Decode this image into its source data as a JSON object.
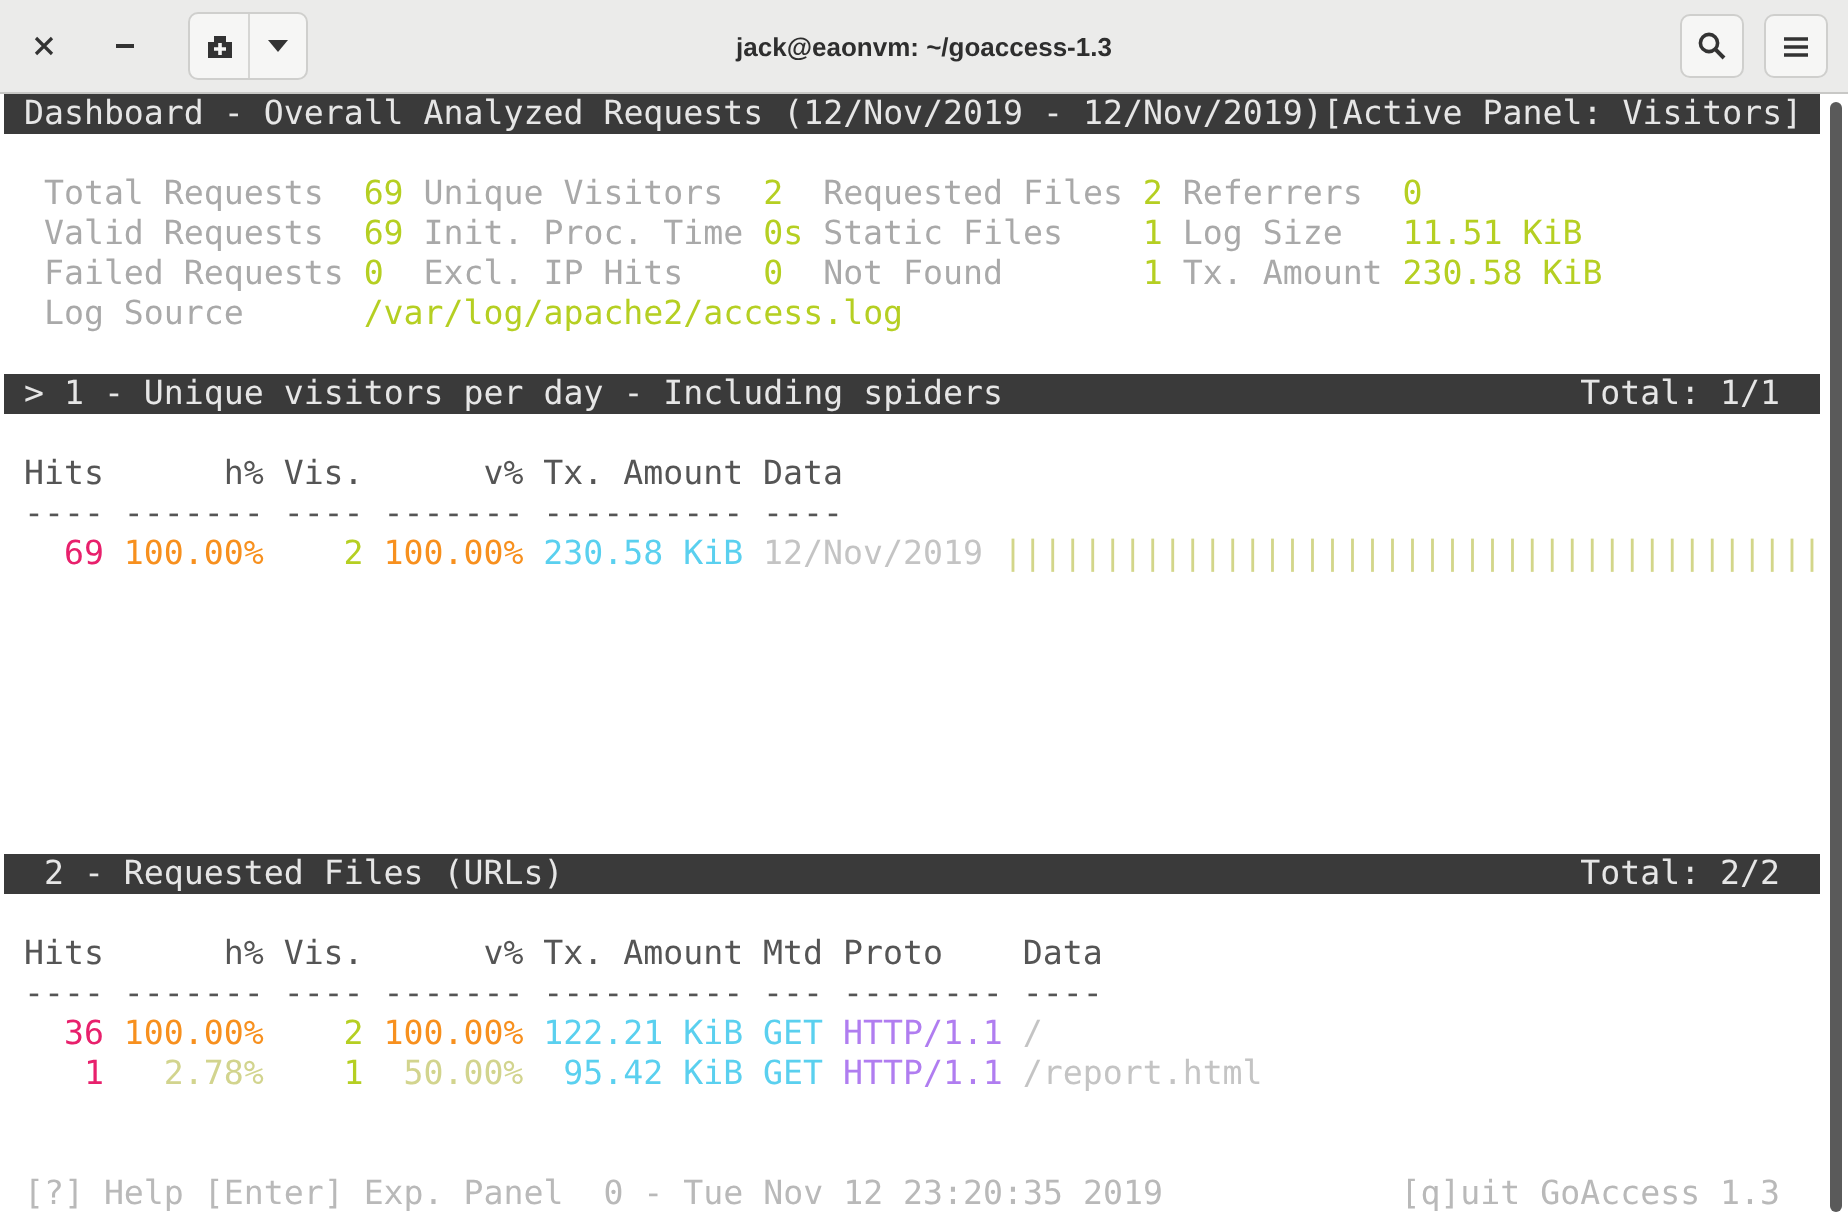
{
  "window": {
    "title": "jack@eaonvm: ~/goaccess-1.3"
  },
  "dashboard": {
    "title": "Dashboard - Overall Analyzed Requests (12/Nov/2019 - 12/Nov/2019)",
    "active_panel": "[Active Panel: Visitors]",
    "stats": [
      [
        {
          "label": "Total Requests",
          "value": "69"
        },
        {
          "label": "Unique Visitors",
          "value": "2"
        },
        {
          "label": "Requested Files",
          "value": "2"
        },
        {
          "label": "Referrers",
          "value": "0"
        }
      ],
      [
        {
          "label": "Valid Requests",
          "value": "69"
        },
        {
          "label": "Init. Proc. Time",
          "value": "0s"
        },
        {
          "label": "Static Files",
          "value": "1"
        },
        {
          "label": "Log Size",
          "value": "11.51 KiB"
        }
      ],
      [
        {
          "label": "Failed Requests",
          "value": "0"
        },
        {
          "label": "Excl. IP Hits",
          "value": "0"
        },
        {
          "label": "Not Found",
          "value": "1"
        },
        {
          "label": "Tx. Amount",
          "value": "230.58 KiB"
        }
      ],
      [
        {
          "label": "Log Source",
          "value": "/var/log/apache2/access.log"
        }
      ]
    ]
  },
  "panels": [
    {
      "marker": ">",
      "title": "1 - Unique visitors per day - Including spiders",
      "total": "Total: 1/1",
      "columns": [
        {
          "kind": "hits",
          "label": "Hits",
          "rule": "----"
        },
        {
          "kind": "percent",
          "label": "h%",
          "rule": "-------"
        },
        {
          "kind": "visitors",
          "label": "Vis.",
          "rule": "----"
        },
        {
          "kind": "percent",
          "label": "v%",
          "rule": "-------"
        },
        {
          "kind": "bandwidth",
          "label": "Tx. Amount",
          "rule": "----------"
        },
        {
          "kind": "data",
          "label": "Data",
          "rule": "----"
        }
      ],
      "rows": [
        {
          "top": true,
          "cells": [
            "69",
            "100.00%",
            "2",
            "100.00%",
            "230.58 KiB",
            "12/Nov/2019"
          ],
          "bar": "|||||||||||||||||||||||||||||||||||||||||"
        }
      ]
    },
    {
      "title": "2 - Requested Files (URLs)",
      "total": "Total: 2/2",
      "columns": [
        {
          "kind": "hits",
          "label": "Hits",
          "rule": "----"
        },
        {
          "kind": "percent",
          "label": "h%",
          "rule": "-------"
        },
        {
          "kind": "visitors",
          "label": "Vis.",
          "rule": "----"
        },
        {
          "kind": "percent",
          "label": "v%",
          "rule": "-------"
        },
        {
          "kind": "bandwidth",
          "label": "Tx. Amount",
          "rule": "----------"
        },
        {
          "kind": "method",
          "label": "Mtd",
          "rule": "---"
        },
        {
          "kind": "protocol",
          "label": "Proto",
          "rule": "--------"
        },
        {
          "kind": "data",
          "label": "Data",
          "rule": "----"
        }
      ],
      "rows": [
        {
          "top": true,
          "cells": [
            "36",
            "100.00%",
            "2",
            "100.00%",
            "122.21 KiB",
            "GET",
            "HTTP/1.1",
            "/"
          ]
        },
        {
          "top": false,
          "cells": [
            "1",
            "2.78%",
            "1",
            "50.00%",
            "95.42 KiB",
            "GET",
            "HTTP/1.1",
            "/report.html"
          ]
        }
      ]
    }
  ],
  "footer": {
    "help": "[?] Help [Enter] Exp. Panel",
    "status": "0 - Tue Nov 12 23:20:35 2019",
    "quit": "[q]uit GoAccess 1.3"
  }
}
